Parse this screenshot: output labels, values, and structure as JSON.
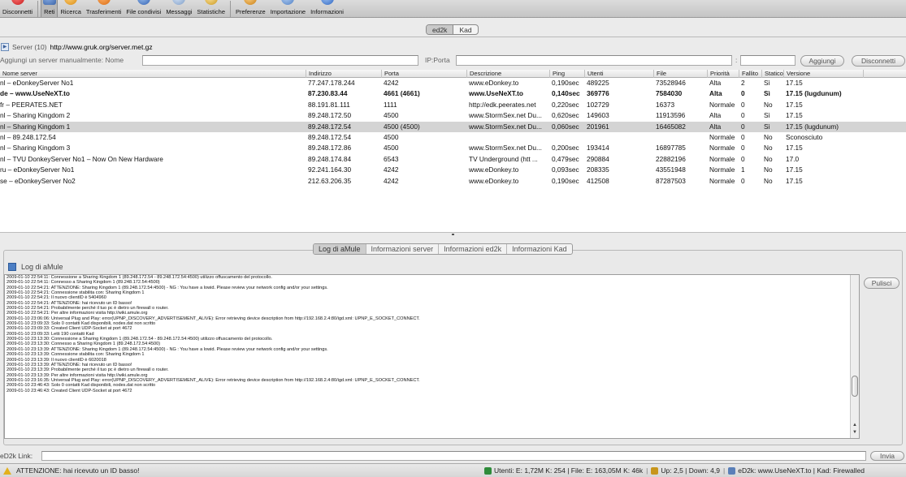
{
  "toolbar": {
    "items": [
      {
        "label": "Disconnetti",
        "icon": "disconnect-icon"
      },
      {
        "label": "Reti",
        "icon": "network-icon"
      },
      {
        "label": "Ricerca",
        "icon": "search-icon"
      },
      {
        "label": "Trasferimenti",
        "icon": "transfers-icon"
      },
      {
        "label": "File condivisi",
        "icon": "shared-files-icon"
      },
      {
        "label": "Messaggi",
        "icon": "messages-icon"
      },
      {
        "label": "Statistiche",
        "icon": "statistics-icon"
      },
      {
        "label": "Preferenze",
        "icon": "preferences-icon"
      },
      {
        "label": "Importazione",
        "icon": "import-icon"
      },
      {
        "label": "Informazioni",
        "icon": "info-icon"
      }
    ],
    "selected": "Reti"
  },
  "network_tabs": [
    "ed2k",
    "Kad"
  ],
  "server_list": {
    "label": "Server (10)",
    "url": "http://www.gruk.org/server.met.gz"
  },
  "add_server": {
    "label": "Aggiungi un server manualmente: Nome",
    "ip_label": "IP:Porta",
    "colon": ":",
    "add_button": "Aggiungi",
    "disconnect_button": "Disconnetti"
  },
  "grid": {
    "columns": [
      "Nome server",
      "Indirizzo",
      "Porta",
      "Descrizione",
      "Ping",
      "Utenti",
      "File",
      "Priorità",
      "Fallito",
      "Statico",
      "Versione"
    ],
    "rows": [
      {
        "name": "nl – eDonkeyServer No1",
        "addr": "77.247.178.244",
        "port": "4242",
        "desc": "www.eDonkey.to",
        "ping": "0,190sec",
        "users": "489225",
        "files": "73528946",
        "prio": "Alta",
        "fail": "2",
        "static": "Sì",
        "ver": "17.15"
      },
      {
        "name": "de – www.UseNeXT.to",
        "addr": "87.230.83.44",
        "port": "4661 (4661)",
        "desc": "www.UseNeXT.to",
        "ping": "0,140sec",
        "users": "369776",
        "files": "7584030",
        "prio": "Alta",
        "fail": "0",
        "static": "Sì",
        "ver": "17.15 (lugdunum)"
      },
      {
        "name": "fr – PEERATES.NET",
        "addr": "88.191.81.111",
        "port": "1111",
        "desc": "http://edk.peerates.net",
        "ping": "0,220sec",
        "users": "102729",
        "files": "16373",
        "prio": "Normale",
        "fail": "0",
        "static": "No",
        "ver": "17.15"
      },
      {
        "name": "nl – Sharing Kingdom 2",
        "addr": "89.248.172.50",
        "port": "4500",
        "desc": "www.StormSex.net Du...",
        "ping": "0,620sec",
        "users": "149603",
        "files": "11913596",
        "prio": "Alta",
        "fail": "0",
        "static": "Sì",
        "ver": "17.15"
      },
      {
        "name": "nl – Sharing Kingdom 1",
        "addr": "89.248.172.54",
        "port": "4500 (4500)",
        "desc": "www.StormSex.net Du...",
        "ping": "0,060sec",
        "users": "201961",
        "files": "16465082",
        "prio": "Alta",
        "fail": "0",
        "static": "Sì",
        "ver": "17.15 (lugdunum)"
      },
      {
        "name": "nl – 89.248.172.54",
        "addr": "89.248.172.54",
        "port": "4500",
        "desc": "",
        "ping": "",
        "users": "",
        "files": "",
        "prio": "Normale",
        "fail": "0",
        "static": "No",
        "ver": "Sconosciuto"
      },
      {
        "name": "nl – Sharing Kingdom 3",
        "addr": "89.248.172.86",
        "port": "4500",
        "desc": "www.StormSex.net Du...",
        "ping": "0,200sec",
        "users": "193414",
        "files": "16897785",
        "prio": "Normale",
        "fail": "0",
        "static": "No",
        "ver": "17.15"
      },
      {
        "name": "nl – TVU DonkeyServer No1 – Now On New Hardware",
        "addr": "89.248.174.84",
        "port": "6543",
        "desc": "TV Underground (htt ...",
        "ping": "0,479sec",
        "users": "290884",
        "files": "22882196",
        "prio": "Normale",
        "fail": "0",
        "static": "No",
        "ver": "17.0"
      },
      {
        "name": "ru – eDonkeyServer No1",
        "addr": "92.241.164.30",
        "port": "4242",
        "desc": "www.eDonkey.to",
        "ping": "0,093sec",
        "users": "208335",
        "files": "43551948",
        "prio": "Normale",
        "fail": "1",
        "static": "No",
        "ver": "17.15"
      },
      {
        "name": "se – eDonkeyServer No2",
        "addr": "212.63.206.35",
        "port": "4242",
        "desc": "www.eDonkey.to",
        "ping": "0,190sec",
        "users": "412508",
        "files": "87287503",
        "prio": "Normale",
        "fail": "0",
        "static": "No",
        "ver": "17.15"
      }
    ]
  },
  "log_tabs": [
    "Log di aMule",
    "Informazioni server",
    "Informazioni ed2k",
    "Informazioni Kad"
  ],
  "log": {
    "title": "Log di aMule",
    "clear_button": "Pulisci",
    "lines": [
      "2009-01-10 22:54:11: Connessione a Sharing Kingdom 1 (89.248.172.54 - 89.248.172.54:4500) utilizzo offuscamento del protocollo.",
      "2009-01-10 22:54:11: Connesso a Sharing Kingdom 1 (89.248.172.54:4500)",
      "2009-01-10 22:54:21: ATTENZIONE: Sharing Kingdom 1 (89.248.172.54:4500) - NG : You have a lowid. Please review your network config and/or your settings.",
      "2009-01-10 22:54:21: Connessione stabilita con: Sharing Kingdom 1",
      "2009-01-10 22:54:21: Il nuovo clientID è 5404960",
      "2009-01-10 22:54:21: ATTENZIONE: hai ricevuto un ID basso!",
      "2009-01-10 22:54:21:   Probabilmente perché il tuo pc è dietro un firewall o router.",
      "2009-01-10 22:54:21:   Per altre informazioni visita http://wiki.amule.org",
      "2009-01-10 23:06:06: Universal Plug and Play: error(UPNP_DISCOVERY_ADVERTISEMENT_ALIVE): Error retrieving device description from http://192.168.2.4:80/igd.xml: UPNP_E_SOCKET_CONNECT.",
      "2009-01-10 23:09:33: Solo 0 contatti Kad disponibili, nodes.dat non scritto",
      "2009-01-10 23:09:33: Created Client UDP-Socket at port 4672",
      "2009-01-10 23:09:33: Letti 190 contatti Kad",
      "2009-01-10 23:13:30: Connessione a Sharing Kingdom 1 (89.248.172.54 - 89.248.172.54:4500) utilizzo offuscamento del protocollo.",
      "2009-01-10 23:13:30: Connesso a Sharing Kingdom 1 (89.248.172.54:4500)",
      "2009-01-10 23:13:39: ATTENZIONE: Sharing Kingdom 1 (89.248.172.54:4500) - NG : You have a lowid. Please review your network config and/or your settings.",
      "2009-01-10 23:13:39: Connessione stabilita con: Sharing Kingdom 1",
      "2009-01-10 23:13:39: Il nuovo clientID è 6020018",
      "2009-01-10 23:13:39: ATTENZIONE: hai ricevuto un ID basso!",
      "2009-01-10 23:13:39:   Probabilmente perché il tuo pc è dietro un firewall o router.",
      "2009-01-10 23:13:39:   Per altre informazioni visita http://wiki.amule.org",
      "2009-01-10 23:16:35: Universal Plug and Play: error(UPNP_DISCOVERY_ADVERTISEMENT_ALIVE): Error retrieving device description from http://192.168.2.4:80/igd.xml: UPNP_E_SOCKET_CONNECT.",
      "2009-01-10 23:46:43: Solo 0 contatti Kad disponibili, nodes.dat non scritto",
      "2009-01-10 23:46:43: Created Client UDP-Socket at port 4672"
    ]
  },
  "ed2k_link": {
    "label": "eD2k Link:",
    "send_button": "Invia"
  },
  "status": {
    "message": "ATTENZIONE: hai ricevuto un ID basso!",
    "users": "Utenti: E: 1,72M K: 254 | File: E: 163,05M K: 46k",
    "rates": "Up: 2,5 | Down: 4,9",
    "connection": "eD2k: www.UseNeXT.to | Kad: Firewalled"
  },
  "colors": {
    "selected_row": "#d4d4d4",
    "warning": "#e3b01c"
  }
}
